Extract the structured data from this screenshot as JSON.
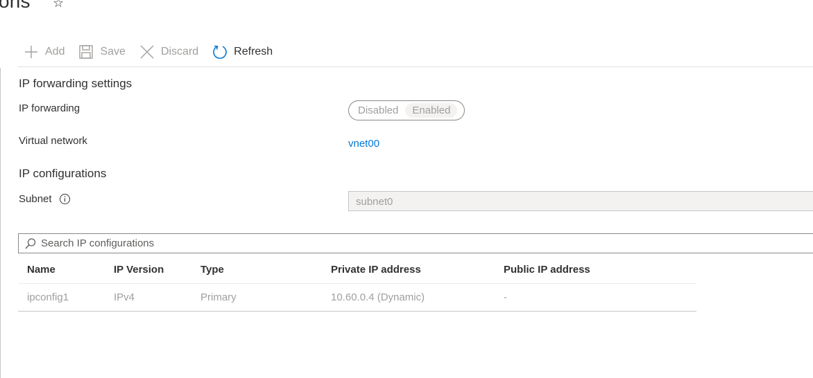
{
  "header": {
    "title_fragment": "ons",
    "more_glyph": "···"
  },
  "toolbar": {
    "add": "Add",
    "save": "Save",
    "discard": "Discard",
    "refresh": "Refresh"
  },
  "ip_forwarding_settings": {
    "title": "IP forwarding settings",
    "ip_forwarding_label": "IP forwarding",
    "toggle_options": [
      "Disabled",
      "Enabled"
    ],
    "selected": "Enabled",
    "virtual_network_label": "Virtual network",
    "virtual_network_value": "vnet00"
  },
  "ip_configurations": {
    "title": "IP configurations",
    "subnet_label": "Subnet",
    "subnet_value": "subnet0",
    "search_placeholder": "Search IP configurations",
    "columns": [
      "Name",
      "IP Version",
      "Type",
      "Private IP address",
      "Public IP address"
    ],
    "rows": [
      [
        "ipconfig1",
        "IPv4",
        "Primary",
        "10.60.0.4 (Dynamic)",
        "-"
      ]
    ]
  },
  "colors": {
    "link": "#0078d4",
    "disabled_text": "#a19f9d",
    "text": "#323130"
  }
}
